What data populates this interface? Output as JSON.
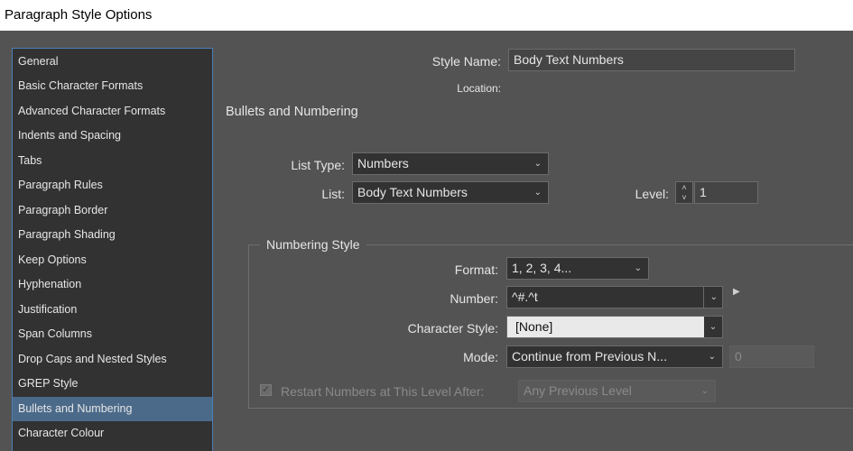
{
  "window": {
    "title": "Paragraph Style Options"
  },
  "sidebar": {
    "items": [
      {
        "label": "General"
      },
      {
        "label": "Basic Character Formats"
      },
      {
        "label": "Advanced Character Formats"
      },
      {
        "label": "Indents and Spacing"
      },
      {
        "label": "Tabs"
      },
      {
        "label": "Paragraph Rules"
      },
      {
        "label": "Paragraph Border"
      },
      {
        "label": "Paragraph Shading"
      },
      {
        "label": "Keep Options"
      },
      {
        "label": "Hyphenation"
      },
      {
        "label": "Justification"
      },
      {
        "label": "Span Columns"
      },
      {
        "label": "Drop Caps and Nested Styles"
      },
      {
        "label": "GREP Style"
      },
      {
        "label": "Bullets and Numbering"
      },
      {
        "label": "Character Colour"
      }
    ],
    "selected": "Bullets and Numbering"
  },
  "header": {
    "style_name_label": "Style Name:",
    "style_name_value": "Body Text Numbers",
    "location_label": "Location:"
  },
  "section": {
    "title": "Bullets and Numbering"
  },
  "list": {
    "list_type_label": "List Type:",
    "list_type_value": "Numbers",
    "list_label": "List:",
    "list_value": "Body Text Numbers",
    "level_label": "Level:",
    "level_value": "1"
  },
  "numbering_style": {
    "group_title": "Numbering Style",
    "format_label": "Format:",
    "format_value": "1, 2, 3, 4...",
    "number_label": "Number:",
    "number_value": "^#.^t",
    "character_style_label": "Character Style:",
    "character_style_value": "[None]",
    "mode_label": "Mode:",
    "mode_value": "Continue from Previous N...",
    "mode_start_value": "0",
    "restart_label": "Restart Numbers at This Level After:",
    "restart_value": "Any Previous Level",
    "restart_checked": true
  },
  "icons": {
    "chevron": "chevron-down-icon",
    "spinner": "spinner-icon",
    "flyout": "play-right-icon",
    "check": "checkmark-icon"
  },
  "colors": {
    "panel": "#535353",
    "sidebar": "#323232",
    "selection": "#4b6a8a",
    "sidebar_border": "#4a7fb5"
  }
}
